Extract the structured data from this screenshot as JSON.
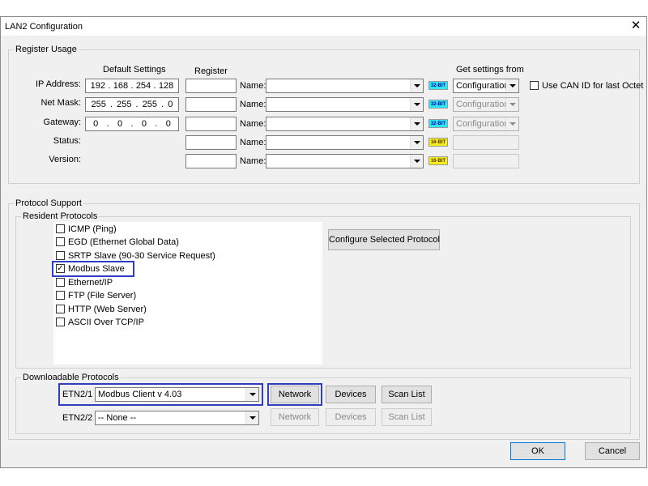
{
  "window": {
    "title": "LAN2 Configuration",
    "close_label": "✕"
  },
  "register_usage": {
    "group_label": "Register Usage",
    "col_default": "Default Settings",
    "col_register": "Register",
    "col_getfrom": "Get settings from",
    "name_label": "Name:",
    "rows": [
      {
        "label": "IP Address:",
        "value": [
          "192",
          "168",
          "254",
          "128"
        ],
        "badge": "32-BIT",
        "getfrom": "Configuration"
      },
      {
        "label": "Net Mask:",
        "value": [
          "255",
          "255",
          "255",
          "0"
        ],
        "badge": "32-BIT",
        "getfrom": "Configuration"
      },
      {
        "label": "Gateway:",
        "value": [
          "0",
          "0",
          "0",
          "0"
        ],
        "badge": "32-BIT",
        "getfrom": "Configuration"
      },
      {
        "label": "Status:",
        "badge": "16-BIT"
      },
      {
        "label": "Version:",
        "badge": "16-BIT"
      }
    ],
    "use_can_id_label": "Use CAN ID for last Octet",
    "use_can_id_checked": false
  },
  "protocol_support": {
    "group_label": "Protocol Support",
    "resident_label": "Resident Protocols",
    "protocols": [
      {
        "label": "ICMP (Ping)",
        "checked": false
      },
      {
        "label": "EGD (Ethernet Global Data)",
        "checked": false
      },
      {
        "label": "SRTP Slave (90-30 Service Request)",
        "checked": false
      },
      {
        "label": "Modbus Slave",
        "checked": true
      },
      {
        "label": "Ethernet/IP",
        "checked": false
      },
      {
        "label": "FTP (File Server)",
        "checked": false
      },
      {
        "label": "HTTP (Web Server)",
        "checked": false
      },
      {
        "label": "ASCII Over TCP/IP",
        "checked": false
      }
    ],
    "check_mark": "✓",
    "configure_button": "Configure Selected Protocol",
    "downloadable_label": "Downloadable Protocols",
    "downloadable": [
      {
        "port": "ETN2/1",
        "protocol": "Modbus Client  v 4.03",
        "network": "Network",
        "devices": "Devices",
        "scan_list": "Scan List"
      },
      {
        "port": "ETN2/2",
        "protocol": "-- None --",
        "network": "Network",
        "devices": "Devices",
        "scan_list": "Scan List"
      }
    ]
  },
  "footer": {
    "ok": "OK",
    "cancel": "Cancel"
  },
  "colors": {
    "highlight": "#2f3ec0",
    "badge_32bit": "#2ee8f5",
    "badge_16bit": "#f5ee1e"
  }
}
